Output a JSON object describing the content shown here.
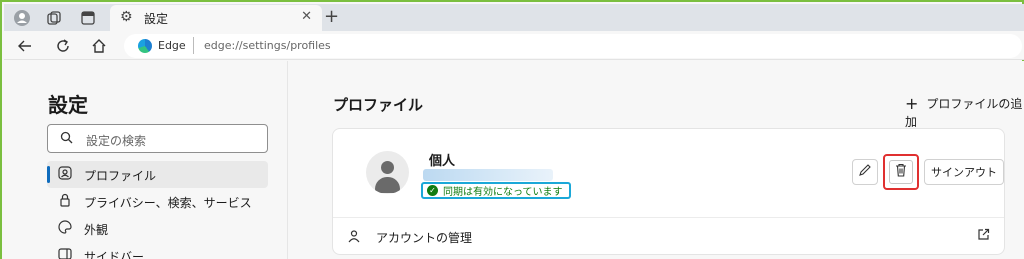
{
  "browser": {
    "tab": {
      "title": "設定",
      "icon": "gear-icon",
      "close_icon": "close-icon"
    },
    "new_tab_icon": "plus-icon",
    "tabstrip_icons": [
      "profile-icon",
      "collections-icon",
      "vertical-tabs-icon"
    ],
    "address": {
      "site_label": "Edge",
      "url": "edge://settings/profiles"
    }
  },
  "sidebar": {
    "title": "設定",
    "search_placeholder": "設定の検索",
    "items": [
      {
        "label": "プロファイル",
        "icon": "profile-card-icon",
        "active": true
      },
      {
        "label": "プライバシー、検索、サービス",
        "icon": "lock-icon",
        "active": false
      },
      {
        "label": "外観",
        "icon": "palette-icon",
        "active": false
      },
      {
        "label": "サイドバー",
        "icon": "sidebar-icon",
        "active": false
      }
    ]
  },
  "main": {
    "title": "プロファイル",
    "add_profile_label": "プロファイルの追加",
    "profile": {
      "name": "個人",
      "sync_status": "同期は有効になっています",
      "signout_label": "サインアウト"
    },
    "manage_account_label": "アカウントの管理"
  },
  "colors": {
    "accent": "#0f6cbd",
    "sync_green": "#107c10",
    "highlight_blue": "#1ba8d8",
    "highlight_red": "#e03030",
    "window_border": "#7bbf3f"
  }
}
